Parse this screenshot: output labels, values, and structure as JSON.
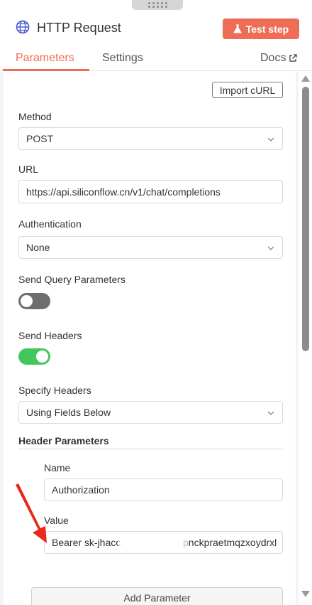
{
  "header": {
    "title": "HTTP Request",
    "test_step_label": "Test step",
    "accent_color": "#ee6e55"
  },
  "tabs": [
    {
      "label": "Parameters",
      "active": true
    },
    {
      "label": "Settings",
      "active": false
    },
    {
      "label": "Docs",
      "active": false
    }
  ],
  "import_curl_label": "Import cURL",
  "method": {
    "label": "Method",
    "value": "POST"
  },
  "url": {
    "label": "URL",
    "value": "https://api.siliconflow.cn/v1/chat/completions"
  },
  "authentication": {
    "label": "Authentication",
    "value": "None"
  },
  "send_query_parameters": {
    "label": "Send Query Parameters",
    "enabled": false
  },
  "send_headers": {
    "label": "Send Headers",
    "enabled": true
  },
  "specify_headers": {
    "label": "Specify Headers",
    "value": "Using Fields Below"
  },
  "header_parameters": {
    "section_title": "Header Parameters",
    "name_label": "Name",
    "name_value": "Authorization",
    "value_label": "Value",
    "value_value": "Bearer sk-jhacc",
    "value_value_tail": "pnckpraetmqzxoydrxl"
  },
  "add_parameter_label": "Add Parameter",
  "annotation": {
    "arrow_color": "#e8291c"
  }
}
